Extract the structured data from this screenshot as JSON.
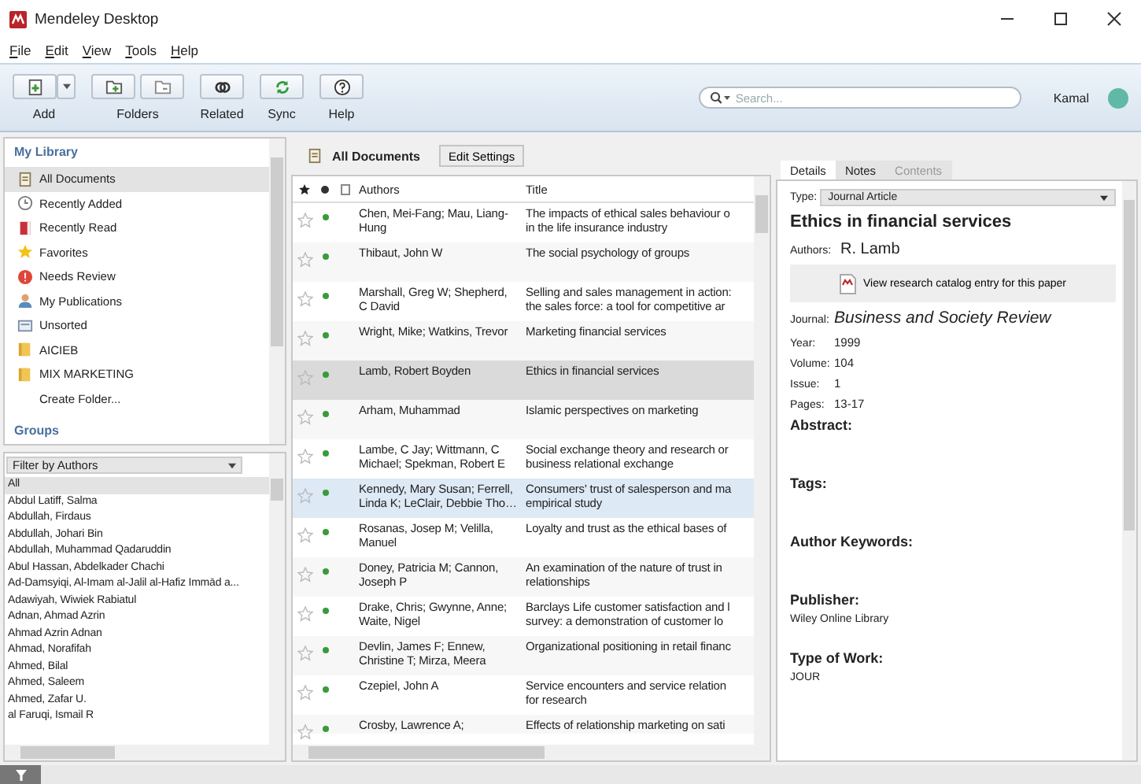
{
  "window": {
    "title": "Mendeley Desktop"
  },
  "menu": [
    "File",
    "Edit",
    "View",
    "Tools",
    "Help"
  ],
  "toolbar": [
    {
      "kind": "add",
      "label": "Add"
    },
    {
      "kind": "folders",
      "label": "Folders"
    },
    {
      "kind": "related",
      "label": "Related"
    },
    {
      "kind": "sync",
      "label": "Sync"
    },
    {
      "kind": "help",
      "label": "Help"
    }
  ],
  "search": {
    "placeholder": "Search..."
  },
  "user": {
    "name": "Kamal"
  },
  "library": {
    "title": "My Library",
    "groups_title": "Groups",
    "items": [
      {
        "kind": "all",
        "label": "All Documents",
        "selected": true
      },
      {
        "kind": "added",
        "label": "Recently Added",
        "selected": false
      },
      {
        "kind": "read",
        "label": "Recently Read",
        "selected": false
      },
      {
        "kind": "favorites",
        "label": "Favorites",
        "selected": false
      },
      {
        "kind": "review",
        "label": "Needs Review",
        "selected": false
      },
      {
        "kind": "publications",
        "label": "My Publications",
        "selected": false
      },
      {
        "kind": "unsorted",
        "label": "Unsorted",
        "selected": false
      },
      {
        "kind": "folder",
        "label": "AICIEB",
        "selected": false
      },
      {
        "kind": "folder",
        "label": "MIX MARKETING",
        "selected": false
      },
      {
        "kind": "create",
        "label": "Create Folder...",
        "selected": false
      }
    ]
  },
  "author_filter": {
    "title": "Filter by Authors",
    "items": [
      {
        "label": "All",
        "selected": true
      },
      {
        "label": "Abdul Latiff, Salma",
        "selected": false
      },
      {
        "label": "Abdullah, Firdaus",
        "selected": false
      },
      {
        "label": "Abdullah, Johari Bin",
        "selected": false
      },
      {
        "label": "Abdullah, Muhammad Qadaruddin",
        "selected": false
      },
      {
        "label": "Abul Hassan, Abdelkader Chachi",
        "selected": false
      },
      {
        "label": "Ad-Damsyiqi, Al-Imam al-Jalil al-Hafiz Immād a...",
        "selected": false
      },
      {
        "label": "Adawiyah, Wiwiek Rabiatul",
        "selected": false
      },
      {
        "label": "Adnan, Ahmad Azrin",
        "selected": false
      },
      {
        "label": "Ahmad Azrin Adnan",
        "selected": false
      },
      {
        "label": "Ahmad, Norafifah",
        "selected": false
      },
      {
        "label": "Ahmed, Bilal",
        "selected": false
      },
      {
        "label": "Ahmed, Saleem",
        "selected": false
      },
      {
        "label": "Ahmed, Zafar U.",
        "selected": false
      },
      {
        "label": "al Faruqi, Ismail R",
        "selected": false
      }
    ]
  },
  "documents": {
    "title": "All Documents",
    "button": "Edit Settings",
    "columns": [
      "Authors",
      "Title"
    ],
    "rows": [
      {
        "authors": "Chen, Mei-Fang; Mau, Liang-\nHung",
        "title": "The impacts of ethical sales behaviour o\nin the life insurance industry",
        "starred": false,
        "unread": true,
        "selected": false,
        "hovered": false
      },
      {
        "authors": "Thibaut, John W",
        "title": "The social psychology of groups",
        "starred": false,
        "unread": true,
        "selected": false,
        "hovered": false
      },
      {
        "authors": "Marshall, Greg W; Shepherd,\nC David",
        "title": "Selling and sales management in action:\nthe sales force: a tool for competitive ar",
        "starred": false,
        "unread": true,
        "selected": false,
        "hovered": false
      },
      {
        "authors": "Wright, Mike; Watkins, Trevor",
        "title": "Marketing financial services",
        "starred": false,
        "unread": true,
        "selected": false,
        "hovered": false
      },
      {
        "authors": "Lamb, Robert Boyden",
        "title": "Ethics in financial services",
        "starred": false,
        "unread": true,
        "selected": true,
        "hovered": false
      },
      {
        "authors": "Arham, Muhammad",
        "title": "Islamic perspectives on marketing",
        "starred": false,
        "unread": true,
        "selected": false,
        "hovered": false
      },
      {
        "authors": "Lambe, C Jay; Wittmann, C\nMichael; Spekman, Robert E",
        "title": "Social exchange theory and research or\nbusiness relational exchange",
        "starred": false,
        "unread": true,
        "selected": false,
        "hovered": false
      },
      {
        "authors": "Kennedy, Mary Susan; Ferrell,\nLinda K; LeClair, Debbie Tho…",
        "title": "Consumers' trust of salesperson and ma\nempirical study",
        "starred": false,
        "unread": true,
        "selected": false,
        "hovered": true
      },
      {
        "authors": "Rosanas, Josep M; Velilla,\nManuel",
        "title": "Loyalty and trust as the ethical bases of",
        "starred": false,
        "unread": true,
        "selected": false,
        "hovered": false
      },
      {
        "authors": "Doney, Patricia M; Cannon,\nJoseph P",
        "title": "An examination of the nature of trust in\nrelationships",
        "starred": false,
        "unread": true,
        "selected": false,
        "hovered": false
      },
      {
        "authors": "Drake, Chris; Gwynne, Anne;\nWaite, Nigel",
        "title": "Barclays Life customer satisfaction and l\nsurvey: a demonstration of customer lo",
        "starred": false,
        "unread": true,
        "selected": false,
        "hovered": false
      },
      {
        "authors": "Devlin, James F; Ennew,\nChristine T; Mirza, Meera",
        "title": "Organizational positioning in retail financ",
        "starred": false,
        "unread": true,
        "selected": false,
        "hovered": false
      },
      {
        "authors": "Czepiel, John A",
        "title": "Service encounters and service relation\nfor research",
        "starred": false,
        "unread": true,
        "selected": false,
        "hovered": false
      },
      {
        "authors": "Crosby, Lawrence A;",
        "title": "Effects of relationship marketing on sati",
        "starred": false,
        "unread": true,
        "selected": false,
        "hovered": false
      }
    ]
  },
  "details": {
    "tabs": [
      {
        "label": "Details",
        "selected": true,
        "disabled": false
      },
      {
        "label": "Notes",
        "selected": false,
        "disabled": false
      },
      {
        "label": "Contents",
        "selected": false,
        "disabled": true
      }
    ],
    "type_label": "Type:",
    "type": "Journal Article",
    "title": "Ethics in financial services",
    "authors_label": "Authors:",
    "authors": "R. Lamb",
    "catalog_button": "View research catalog entry for this paper",
    "fields": [
      {
        "kind": "journal",
        "label": "Journal:",
        "value": "Business and Society Review"
      },
      {
        "kind": "plain",
        "label": "Year:",
        "value": "1999"
      },
      {
        "kind": "plain",
        "label": "Volume:",
        "value": "104"
      },
      {
        "kind": "plain",
        "label": "Issue:",
        "value": "1"
      },
      {
        "kind": "plain",
        "label": "Pages:",
        "value": "13-17"
      }
    ],
    "sections": [
      {
        "title": "Abstract:"
      },
      {
        "title": "Tags:"
      },
      {
        "title": "Author Keywords:"
      },
      {
        "title": "Publisher:",
        "value": "Wiley Online Library"
      },
      {
        "title": "Type of Work:",
        "value": "JOUR"
      }
    ]
  }
}
